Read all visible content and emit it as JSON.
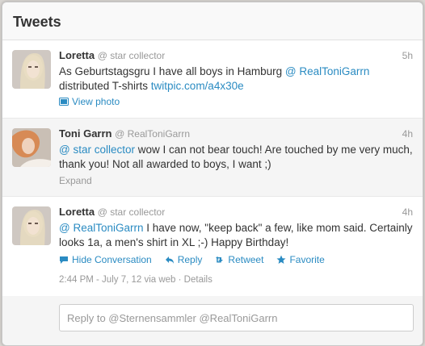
{
  "header": {
    "title": "Tweets"
  },
  "tweets": [
    {
      "fullname": "Loretta",
      "screenname": "@ star collector",
      "time": "5h",
      "text_a": "As Geburtstagsgru I have all boys in Hamburg ",
      "mention": "@ RealToniGarrn",
      "text_b": " distributed T-shirts ",
      "link": "twitpic.com/a4x30e",
      "view_photo": "View photo"
    },
    {
      "fullname": "Toni Garrn",
      "screenname": "@ RealToniGarrn",
      "time": "4h",
      "mention": "@ star collector",
      "text": " wow I can not bear touch! Are touched by me very much, thank you! Not all awarded to boys, I want ;)",
      "expand": "Expand"
    },
    {
      "fullname": "Loretta",
      "screenname": "@ star collector",
      "time": "4h",
      "mention": "@ RealToniGarrn",
      "text": " I have now, \"keep back\" a few, like mom said. Certainly looks 1a, a men's shirt in XL ;-) Happy Birthday!",
      "actions": {
        "hide": "Hide Conversation",
        "reply": "Reply",
        "retweet": "Retweet",
        "favorite": "Favorite"
      },
      "details": "2:44 PM - July 7, 12 via web · Details"
    }
  ],
  "reply": {
    "placeholder": "Reply to @Sternensammler @RealToniGarrn"
  },
  "colors": {
    "link": "#2a8bc2",
    "muted": "#999999"
  }
}
